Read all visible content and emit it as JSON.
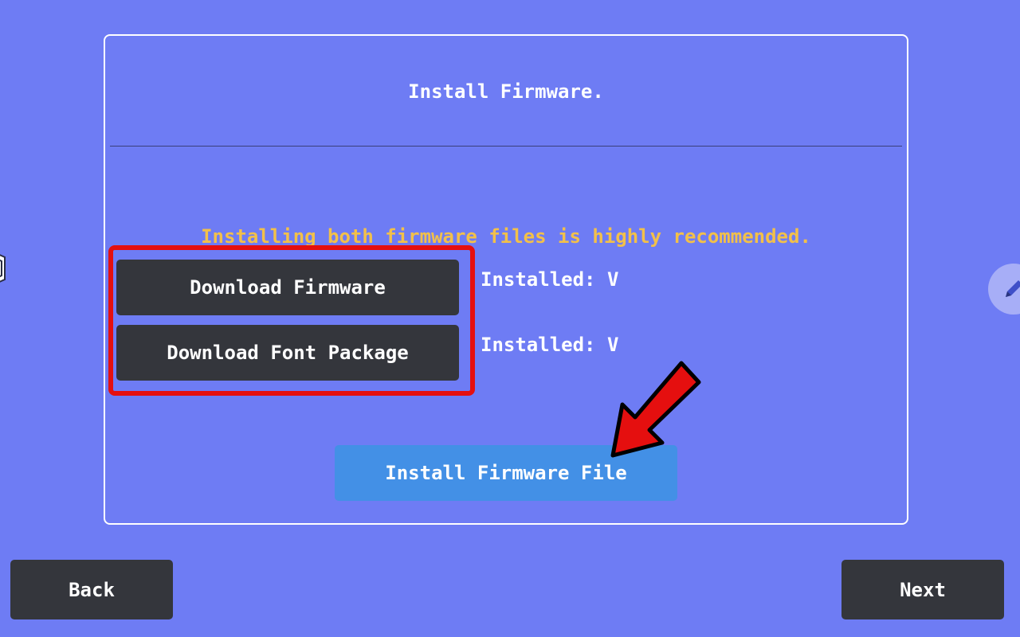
{
  "dialog": {
    "title": "Install Firmware.",
    "recommendation": "Installing both firmware files is highly recommended."
  },
  "downloads": {
    "firmware_label": "Download Firmware",
    "firmware_status": "Installed: V",
    "font_label": "Download Font Package",
    "font_status": "Installed: V"
  },
  "install_file_label": "Install Firmware File",
  "navigation": {
    "back_label": "Back",
    "next_label": "Next"
  },
  "side_icons": {
    "left": "settings-icon",
    "right": "pencil-icon"
  },
  "annotations": {
    "highlight_color": "#e50f0f",
    "arrow_color": "#e50f0f"
  },
  "colors": {
    "background": "#6e7cf4",
    "dark_button": "#34363c",
    "primary_button": "#4390e6",
    "note_text": "#f2c04a"
  }
}
